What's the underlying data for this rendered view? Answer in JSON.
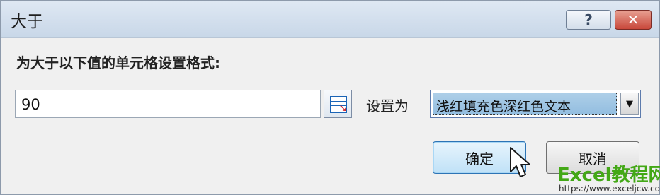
{
  "dialog": {
    "title": "大于",
    "help_label": "?",
    "close_label": "✕",
    "prompt": "为大于以下值的单元格设置格式:",
    "value": "90",
    "format_label": "设置为",
    "format_selected": "浅红填充色深红色文本",
    "dropdown_arrow": "▼",
    "ok_label": "确定",
    "cancel_label": "取消",
    "ref_arrow": "➘"
  },
  "watermark": {
    "title": "Excel教程网",
    "url": "https://www.exceljcw.com"
  },
  "icons": {
    "help": "help-icon",
    "close": "close-icon",
    "range": "range-select-icon",
    "dropdown": "dropdown-arrow-icon",
    "cursor": "mouse-pointer-icon"
  }
}
